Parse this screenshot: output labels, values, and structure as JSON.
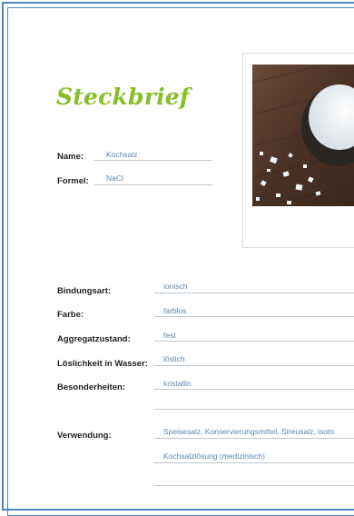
{
  "title": "Steckbrief",
  "fields": {
    "name_label": "Name:",
    "name_value": "Kochsalz",
    "formel_label": "Formel:",
    "formel_value": "NaCl",
    "bindungsart_label": "Bindungsart:",
    "bindungsart_value": "ionisch",
    "farbe_label": "Farbe:",
    "farbe_value": "farblos",
    "aggregatzustand_label": "Aggregatzustand:",
    "aggregatzustand_value": "fest",
    "loeslichkeit_label": "Löslichkeit in Wasser:",
    "loeslichkeit_value": "löslich",
    "besonderheiten_label": "Besonderheiten:",
    "besonderheiten_value": "kristallin",
    "verwendung_label": "Verwendung:",
    "verwendung_value_1": "Speisesalz, Konservierungsmittel, Streusalz, isoto",
    "verwendung_value_2": "Kochsalzlösung (medizinisch)"
  },
  "colors": {
    "title": "#86bf2a",
    "border": "#4f86c6",
    "value_text": "#5b86ad"
  }
}
